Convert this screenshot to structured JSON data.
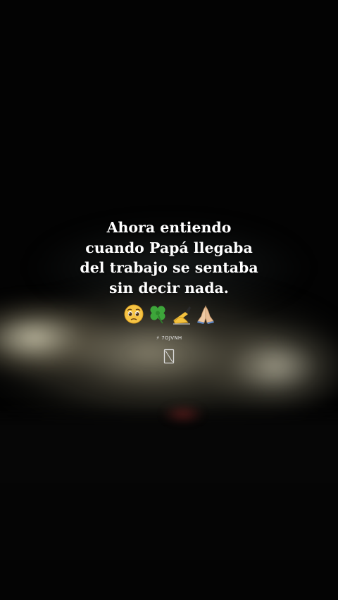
{
  "caption": {
    "lines": [
      "Ahora entiendo",
      "cuando Papá llegaba",
      "del trabajo se sentaba",
      "sin decir nada."
    ]
  },
  "emojis": [
    {
      "icon": "pleading-face-icon",
      "glyph": "🥺"
    },
    {
      "icon": "four-leaf-clover-icon",
      "glyph": "🍀"
    },
    {
      "icon": "writing-hand-icon",
      "glyph": "✍"
    },
    {
      "icon": "folded-hands-icon",
      "glyph": "🙏"
    }
  ],
  "handle": {
    "text": "⚡ 7OJVNH"
  },
  "colors": {
    "background": "#030303",
    "text": "#ffffff",
    "road_light": "#d2c8aa"
  }
}
